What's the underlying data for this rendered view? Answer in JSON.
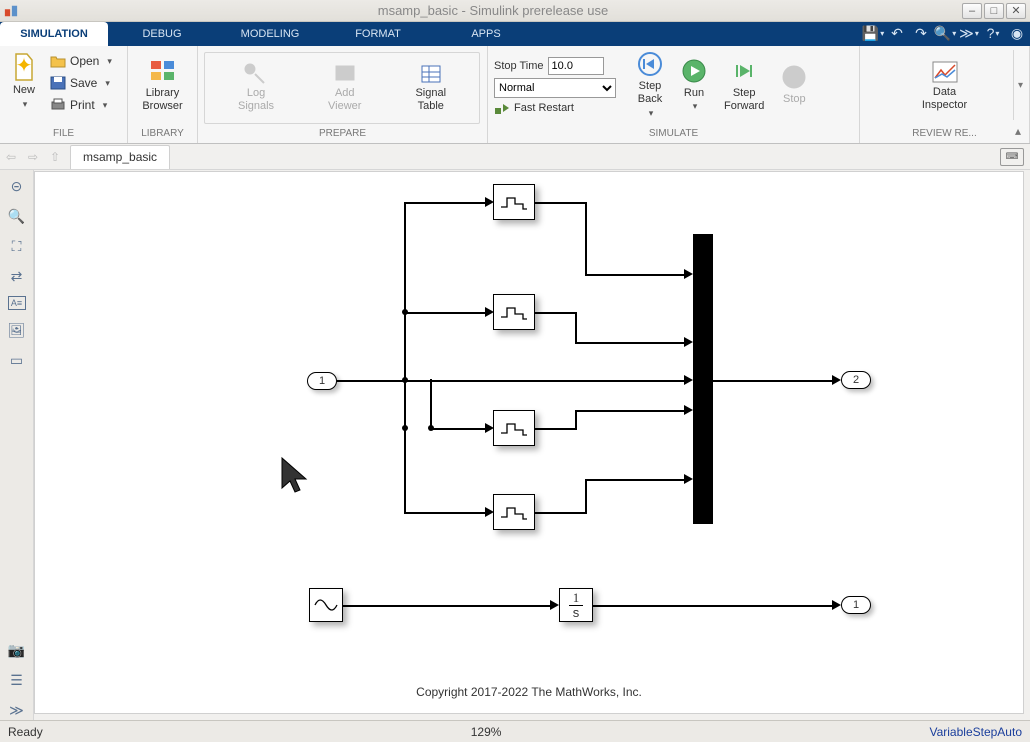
{
  "window": {
    "title": "msamp_basic - Simulink prerelease use"
  },
  "tabs": {
    "items": [
      {
        "label": "SIMULATION",
        "active": true
      },
      {
        "label": "DEBUG",
        "active": false
      },
      {
        "label": "MODELING",
        "active": false
      },
      {
        "label": "FORMAT",
        "active": false
      },
      {
        "label": "APPS",
        "active": false
      }
    ]
  },
  "toolstrip": {
    "file": {
      "new_label": "New",
      "open_label": "Open",
      "save_label": "Save",
      "print_label": "Print",
      "group_label": "FILE"
    },
    "library": {
      "label": "Library\nBrowser",
      "group_label": "LIBRARY"
    },
    "prepare": {
      "log_label": "Log\nSignals",
      "viewer_label": "Add\nViewer",
      "sigtab_label": "Signal\nTable",
      "group_label": "PREPARE"
    },
    "simulate": {
      "stop_time_label": "Stop Time",
      "stop_time_value": "10.0",
      "mode_value": "Normal",
      "fast_restart_label": "Fast Restart",
      "step_back_label": "Step\nBack",
      "run_label": "Run",
      "step_fwd_label": "Step\nForward",
      "stop_label": "Stop",
      "group_label": "SIMULATE"
    },
    "review": {
      "data_insp_label": "Data\nInspector",
      "group_label": "REVIEW RE..."
    }
  },
  "breadcrumb": {
    "name": "msamp_basic"
  },
  "diagram": {
    "inport1": "1",
    "outport2": "2",
    "outport1": "1",
    "integrator": "1\ns",
    "copyright": "Copyright 2017-2022 The MathWorks, Inc."
  },
  "status": {
    "ready": "Ready",
    "zoom": "129%",
    "solver": "VariableStepAuto"
  }
}
